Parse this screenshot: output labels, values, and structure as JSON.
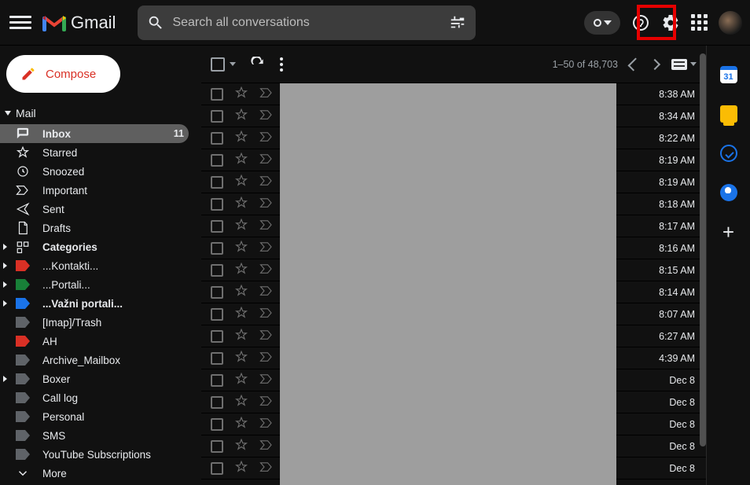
{
  "header": {
    "logo_text": "Gmail",
    "search_placeholder": "Search all conversations"
  },
  "compose_label": "Compose",
  "section_label": "Mail",
  "nav": [
    {
      "key": "inbox",
      "label": "Inbox",
      "count": "11"
    },
    {
      "key": "starred",
      "label": "Starred"
    },
    {
      "key": "snoozed",
      "label": "Snoozed"
    },
    {
      "key": "important",
      "label": "Important"
    },
    {
      "key": "sent",
      "label": "Sent"
    },
    {
      "key": "drafts",
      "label": "Drafts"
    },
    {
      "key": "categories",
      "label": "Categories"
    },
    {
      "key": "kontakti",
      "label": "...Kontakti..."
    },
    {
      "key": "portali",
      "label": "...Portali..."
    },
    {
      "key": "vazni",
      "label": "...Važni portali..."
    },
    {
      "key": "imap_trash",
      "label": "[Imap]/Trash"
    },
    {
      "key": "ah",
      "label": "AH"
    },
    {
      "key": "archive_mailbox",
      "label": "Archive_Mailbox"
    },
    {
      "key": "boxer",
      "label": "Boxer"
    },
    {
      "key": "call_log",
      "label": "Call log"
    },
    {
      "key": "personal",
      "label": "Personal"
    },
    {
      "key": "sms",
      "label": "SMS"
    },
    {
      "key": "youtube_subs",
      "label": "YouTube Subscriptions"
    },
    {
      "key": "more",
      "label": "More"
    }
  ],
  "pager_text": "1–50 of 48,703",
  "rows": [
    {
      "time": "8:38 AM"
    },
    {
      "time": "8:34 AM"
    },
    {
      "time": "8:22 AM"
    },
    {
      "time": "8:19 AM"
    },
    {
      "time": "8:19 AM"
    },
    {
      "time": "8:18 AM"
    },
    {
      "time": "8:17 AM"
    },
    {
      "time": "8:16 AM"
    },
    {
      "time": "8:15 AM"
    },
    {
      "time": "8:14 AM"
    },
    {
      "time": "8:07 AM"
    },
    {
      "time": "6:27 AM"
    },
    {
      "time": "4:39 AM"
    },
    {
      "time": "Dec 8"
    },
    {
      "time": "Dec 8"
    },
    {
      "time": "Dec 8"
    },
    {
      "time": "Dec 8"
    },
    {
      "time": "Dec 8"
    }
  ],
  "calendar_day": "31",
  "label_colors": {
    "kontakti": "#d93025",
    "portali": "#188038",
    "vazni": "#1a73e8",
    "ah": "#d93025"
  },
  "grey_label": "#5f6368"
}
